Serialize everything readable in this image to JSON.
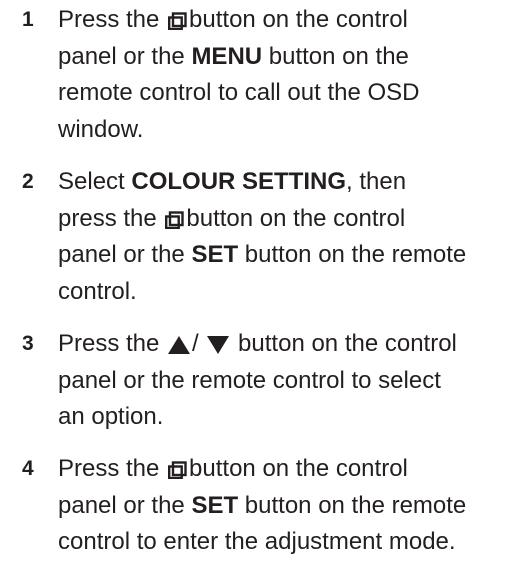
{
  "steps": [
    {
      "number": "1",
      "lines": [
        {
          "a": "Press the ",
          "icon": "menu-button-icon",
          "b": "button on the control"
        },
        {
          "a": "panel or the ",
          "bold": "MENU",
          "b": " button on the"
        },
        {
          "a": "remote control to call out the OSD"
        },
        {
          "a": "window."
        }
      ]
    },
    {
      "number": "2",
      "lines": [
        {
          "a": "Select ",
          "bold": "COLOUR SETTING",
          "b": ", then"
        },
        {
          "a": "press the ",
          "icon": "menu-button-icon",
          "b": "button on the control"
        },
        {
          "a": "panel or the ",
          "bold": "SET",
          "b": " button on the remote"
        },
        {
          "a": "control."
        }
      ]
    },
    {
      "number": "3",
      "lines": [
        {
          "a": "Press the ",
          "icon1": "up-triangle-icon",
          "sep": "/ ",
          "icon2": "down-triangle-icon",
          "b": " button on the control"
        },
        {
          "a": "panel or the remote control to select"
        },
        {
          "a": "an option."
        }
      ]
    },
    {
      "number": "4",
      "lines": [
        {
          "a": "Press the ",
          "icon": "menu-button-icon",
          "b": "button on the control"
        },
        {
          "a": "panel or the ",
          "bold": "SET",
          "b": " button on the remote"
        },
        {
          "a": "control to enter the adjustment mode."
        }
      ]
    }
  ]
}
